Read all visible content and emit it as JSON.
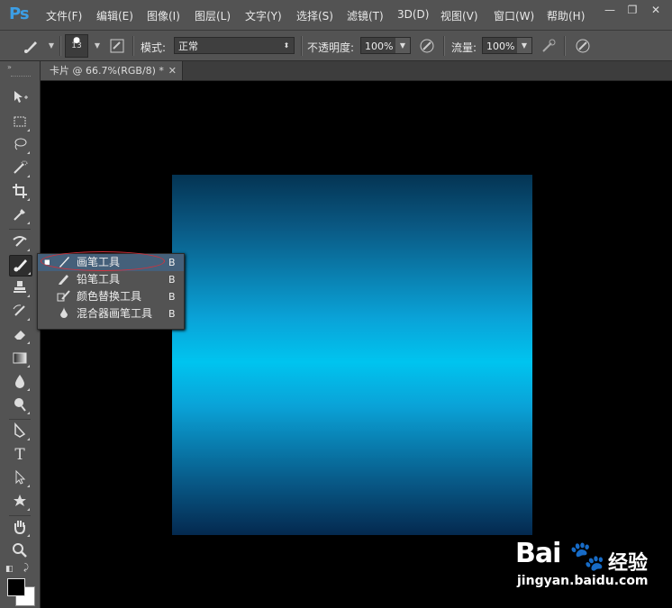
{
  "app": {
    "logo": "Ps"
  },
  "menubar": {
    "items": [
      "文件(F)",
      "编辑(E)",
      "图像(I)",
      "图层(L)",
      "文字(Y)",
      "选择(S)",
      "滤镜(T)",
      "3D(D)",
      "视图(V)",
      "窗口(W)",
      "帮助(H)"
    ],
    "window_controls": [
      "minimize-icon",
      "restore-icon",
      "close-icon"
    ]
  },
  "options": {
    "brush_size": "13",
    "mode_label": "模式:",
    "mode_value": "正常",
    "opacity_label": "不透明度:",
    "opacity_value": "100%",
    "flow_label": "流量:",
    "flow_value": "100%"
  },
  "document": {
    "tab_title": "卡片 @ 66.7%(RGB/8) *",
    "canvas_gradient": [
      "#043453",
      "#00c4ef",
      "#04294f"
    ]
  },
  "toolbar": {
    "tools": [
      "move-tool-icon",
      "marquee-tool-icon",
      "lasso-tool-icon",
      "quick-select-tool-icon",
      "crop-tool-icon",
      "eyedropper-tool-icon",
      "healing-tool-icon",
      "brush-tool-icon",
      "stamp-tool-icon",
      "history-brush-tool-icon",
      "eraser-tool-icon",
      "gradient-tool-icon",
      "blur-tool-icon",
      "dodge-tool-icon",
      "pen-tool-icon",
      "type-tool-icon",
      "path-select-tool-icon",
      "shape-tool-icon",
      "hand-tool-icon",
      "zoom-tool-icon"
    ],
    "active_tool": "brush-tool-icon",
    "type_tool_label": "T",
    "foreground_color": "#000000",
    "background_color": "#ffffff"
  },
  "flyout": {
    "items": [
      {
        "label": "画笔工具",
        "key": "B",
        "selected": true
      },
      {
        "label": "铅笔工具",
        "key": "B",
        "selected": false
      },
      {
        "label": "颜色替换工具",
        "key": "B",
        "selected": false
      },
      {
        "label": "混合器画笔工具",
        "key": "B",
        "selected": false
      }
    ]
  },
  "watermark": {
    "brand": "Bai",
    "brand_suffix": "经验",
    "url": "jingyan.baidu.com"
  }
}
